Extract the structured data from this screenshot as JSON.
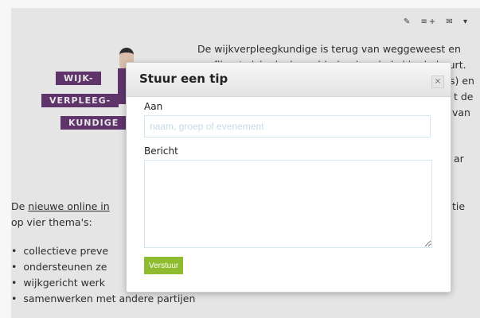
{
  "toolbar": {
    "icons": [
      "pencil-icon",
      "add-list-icon",
      "mail-icon",
      "chevron-down-icon"
    ]
  },
  "illustration": {
    "sign_1": "WIJK-",
    "sign_2": "VERPLEEG-",
    "sign_3": "KUNDIGE"
  },
  "background": {
    "paragraph_line_1": "De wijkverpleegkundige is terug van weggeweest en",
    "paragraph_line_2": "profileert zich als de verbindende schakel in de buurt.",
    "fragment_right_1": "s) en",
    "fragment_right_2": "t de",
    "fragment_right_3": "van",
    "fragment_right_4": "ar",
    "lower_prefix": "De ",
    "lower_link": "nieuwe online in",
    "lower_suffix": "tie",
    "lower_line_2": "op vier thema's:",
    "bullets": [
      "collectieve preve",
      "ondersteunen ze",
      "wijkgericht werk",
      "samenwerken met andere partijen"
    ]
  },
  "modal": {
    "title": "Stuur een tip",
    "close_label": "×",
    "to_label": "Aan",
    "to_placeholder": "naam, groep of evenement",
    "message_label": "Bericht",
    "submit_label": "Verstuur"
  }
}
